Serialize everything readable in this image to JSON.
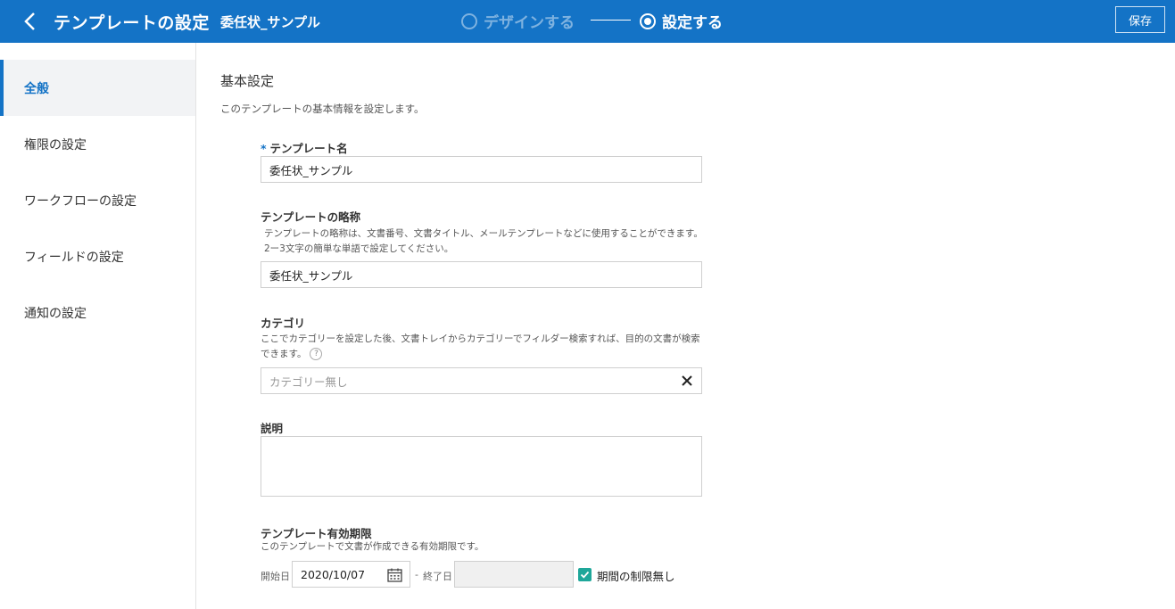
{
  "header": {
    "title": "テンプレートの設定",
    "subtitle": "委任状_サンプル",
    "steps": [
      {
        "label": "デザインする",
        "active": false
      },
      {
        "label": "設定する",
        "active": true
      }
    ],
    "save_label": "保存",
    "accent_color": "#1473c6"
  },
  "sidebar": {
    "items": [
      {
        "label": "全般",
        "active": true
      },
      {
        "label": "権限の設定",
        "active": false
      },
      {
        "label": "ワークフローの設定",
        "active": false
      },
      {
        "label": "フィールドの設定",
        "active": false
      },
      {
        "label": "通知の設定",
        "active": false
      }
    ]
  },
  "main": {
    "section_title": "基本設定",
    "section_desc": "このテンプレートの基本情報を設定します。",
    "template_name": {
      "required_mark": "*",
      "label": "テンプレート名",
      "value": "委任状_サンプル"
    },
    "abbreviation": {
      "label": "テンプレートの略称",
      "hint": "テンプレートの略称は、文書番号、文書タイトル、メールテンプレートなどに使用することができます。2ー3文字の簡単な単語で設定してください。",
      "value": "委任状_サンプル"
    },
    "category": {
      "label": "カテゴリ",
      "hint": "ここでカテゴリーを設定した後、文書トレイからカテゴリーでフィルダー検索すれば、目的の文書が検索できます。",
      "help_glyph": "?",
      "placeholder": "カテゴリー無し"
    },
    "description": {
      "label": "説明",
      "value": ""
    },
    "validity": {
      "label": "テンプレート有効期限",
      "hint": "このテンプレートで文書が作成できる有効期限です。",
      "start_label": "開始日",
      "start_value": "2020/10/07",
      "separator": "-",
      "end_label": "終了日",
      "end_value": "",
      "no_limit_label": "期間の制限無し",
      "no_limit_checked": true,
      "check_color": "#1fa79a"
    }
  }
}
